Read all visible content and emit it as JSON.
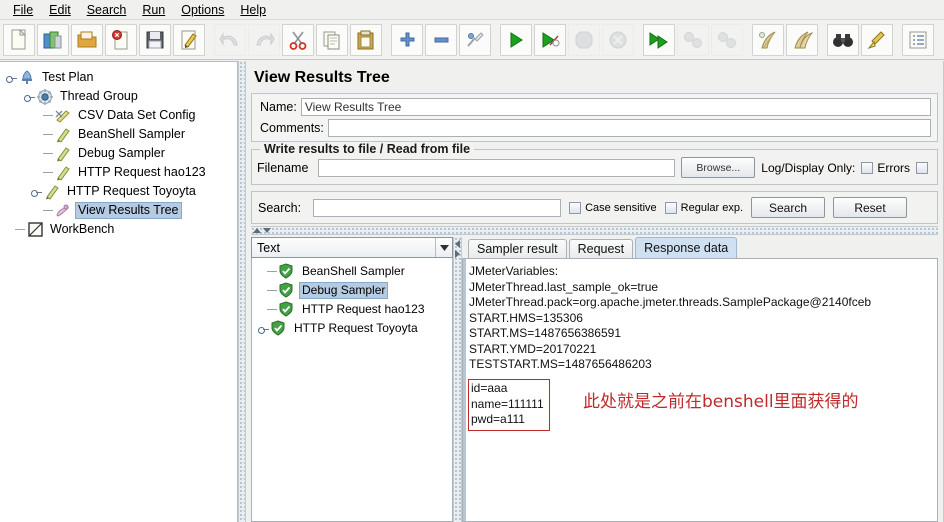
{
  "menubar": {
    "items": [
      {
        "label": "File",
        "mnemonic": "F"
      },
      {
        "label": "Edit",
        "mnemonic": "E"
      },
      {
        "label": "Search",
        "mnemonic": "S"
      },
      {
        "label": "Run",
        "mnemonic": "R"
      },
      {
        "label": "Options",
        "mnemonic": "O"
      },
      {
        "label": "Help",
        "mnemonic": "H"
      }
    ]
  },
  "toolbar": {
    "buttons": [
      {
        "name": "new-icon",
        "tooltip": "New"
      },
      {
        "name": "templates-icon",
        "tooltip": "Templates"
      },
      {
        "name": "open-icon",
        "tooltip": "Open"
      },
      {
        "name": "close-icon",
        "tooltip": "Close"
      },
      {
        "name": "save-icon",
        "tooltip": "Save"
      },
      {
        "name": "save-as-icon",
        "tooltip": "Save Test Plan as"
      },
      {
        "name": "undo-icon",
        "tooltip": "Undo",
        "disabled": true
      },
      {
        "name": "redo-icon",
        "tooltip": "Redo",
        "disabled": true
      },
      {
        "name": "cut-icon",
        "tooltip": "Cut"
      },
      {
        "name": "copy-icon",
        "tooltip": "Copy"
      },
      {
        "name": "paste-icon",
        "tooltip": "Paste"
      },
      {
        "name": "expand-all-icon",
        "tooltip": "Expand All"
      },
      {
        "name": "collapse-all-icon",
        "tooltip": "Collapse All"
      },
      {
        "name": "toggle-icon",
        "tooltip": "Toggle"
      },
      {
        "name": "start-icon",
        "tooltip": "Start"
      },
      {
        "name": "start-no-pauses-icon",
        "tooltip": "Start no pauses"
      },
      {
        "name": "stop-icon",
        "tooltip": "Stop",
        "disabled": true
      },
      {
        "name": "shutdown-icon",
        "tooltip": "Shutdown",
        "disabled": true
      },
      {
        "name": "remote-start-all-icon",
        "tooltip": "Remote Start All"
      },
      {
        "name": "remote-stop-all-icon",
        "tooltip": "Remote Stop All",
        "disabled": true
      },
      {
        "name": "remote-shutdown-all-icon",
        "tooltip": "Remote Shutdown All",
        "disabled": true
      },
      {
        "name": "clear-icon",
        "tooltip": "Clear"
      },
      {
        "name": "clear-all-icon",
        "tooltip": "Clear All"
      },
      {
        "name": "search-icon",
        "tooltip": "Search"
      },
      {
        "name": "search-reset-icon",
        "tooltip": "Reset Search"
      },
      {
        "name": "function-helper-icon",
        "tooltip": "Function Helper Dialog"
      }
    ]
  },
  "tree": {
    "nodes": [
      {
        "label": "Test Plan",
        "icon": "test-plan-icon",
        "depth": 0,
        "expanded": true,
        "selected": false
      },
      {
        "label": "Thread Group",
        "icon": "thread-group-icon",
        "depth": 1,
        "expanded": true,
        "selected": false
      },
      {
        "label": "CSV Data Set Config",
        "icon": "csv-data-set-icon",
        "depth": 2,
        "expanded": false,
        "selected": false
      },
      {
        "label": "BeanShell Sampler",
        "icon": "sampler-icon",
        "depth": 2,
        "expanded": false,
        "selected": false
      },
      {
        "label": "Debug Sampler",
        "icon": "sampler-icon",
        "depth": 2,
        "expanded": false,
        "selected": false
      },
      {
        "label": "HTTP Request  hao123",
        "icon": "sampler-icon",
        "depth": 2,
        "expanded": false,
        "selected": false
      },
      {
        "label": "HTTP Request  Toyoyta",
        "icon": "sampler-icon",
        "depth": 2,
        "expanded": true,
        "selected": false
      },
      {
        "label": "View Results Tree",
        "icon": "view-results-tree-icon",
        "depth": 2,
        "expanded": false,
        "selected": true
      },
      {
        "label": "WorkBench",
        "icon": "workbench-icon",
        "depth": 0,
        "expanded": false,
        "selected": false
      }
    ]
  },
  "panel": {
    "title": "View Results Tree",
    "name_label": "Name:",
    "name_value": "View Results Tree",
    "comments_label": "Comments:",
    "comments_value": "",
    "file_group": {
      "title": "Write results to file / Read from file",
      "filename_label": "Filename",
      "filename_value": "",
      "filename_placeholder": "",
      "browse_label": "Browse...",
      "log_display_label": "Log/Display Only:",
      "errors_label": "Errors",
      "successes_label": ""
    },
    "search": {
      "label": "Search:",
      "value": "",
      "placeholder": "",
      "case_sensitive_label": "Case sensitive",
      "regular_exp_label": "Regular exp.",
      "search_button": "Search",
      "reset_button": "Reset"
    }
  },
  "results": {
    "renderer_selected": "Text",
    "renderer_options": [
      "Text"
    ],
    "samples": [
      {
        "label": "BeanShell Sampler",
        "status": "success",
        "selected": false,
        "expandable": false
      },
      {
        "label": "Debug Sampler",
        "status": "success",
        "selected": true,
        "expandable": false
      },
      {
        "label": "HTTP Request  hao123",
        "status": "success",
        "selected": false,
        "expandable": false
      },
      {
        "label": "HTTP Request  Toyoyta",
        "status": "success",
        "selected": false,
        "expandable": true
      }
    ],
    "tabs": [
      {
        "label": "Sampler result",
        "active": false
      },
      {
        "label": "Request",
        "active": false
      },
      {
        "label": "Response data",
        "active": true
      }
    ],
    "response_lines": [
      "JMeterVariables:",
      "JMeterThread.last_sample_ok=true",
      "JMeterThread.pack=org.apache.jmeter.threads.SamplePackage@2140fceb",
      "START.HMS=135306",
      "START.MS=1487656386591",
      "START.YMD=20170221",
      "TESTSTART.MS=1487656486203"
    ],
    "highlight_lines": [
      "id=aaa",
      "name=111111",
      "pwd=a111"
    ],
    "annotation_text": "此处就是之前在benshell里面获得的"
  },
  "colors": {
    "accent": "#b5cbe3",
    "annotation_red": "#c02a2a",
    "tab_active": "#cfe0f2",
    "success_green": "#45a145"
  }
}
